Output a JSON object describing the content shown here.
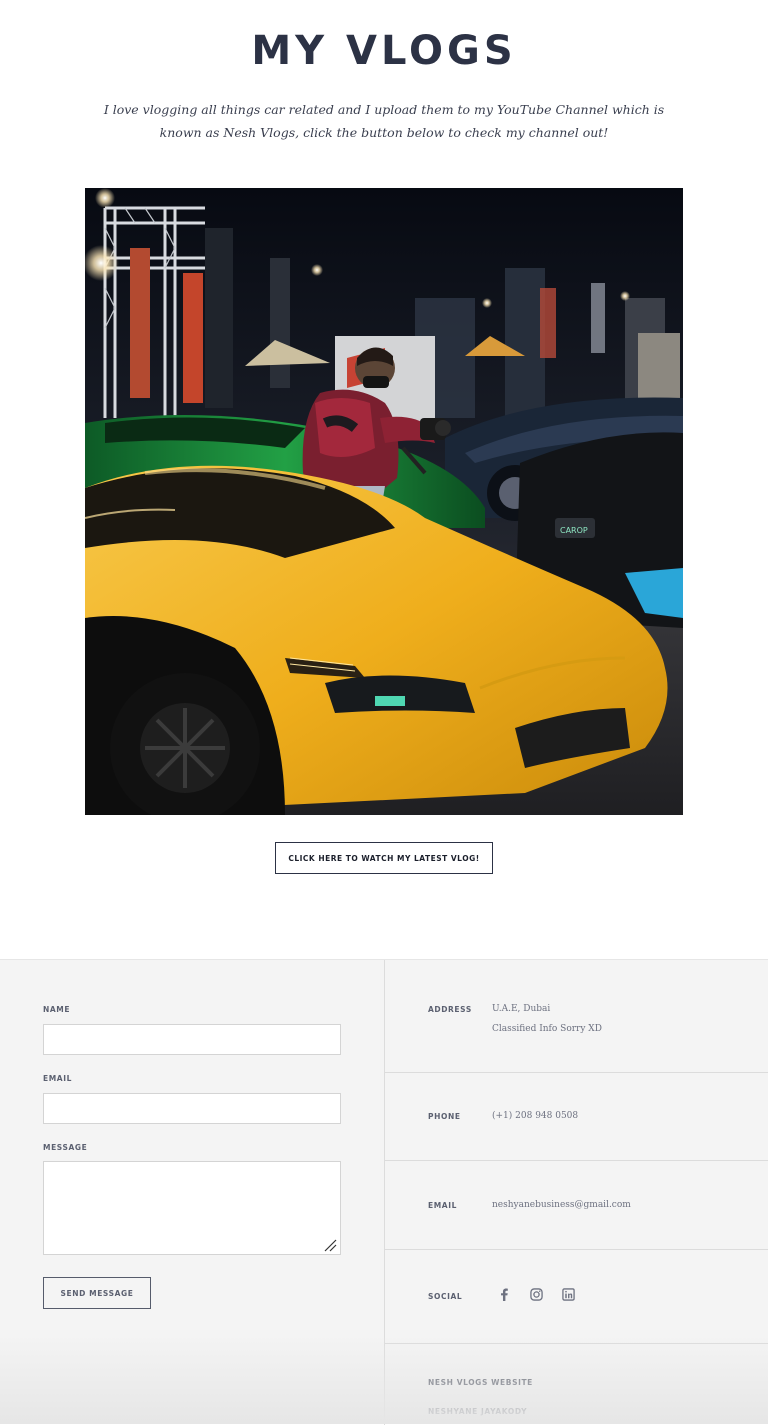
{
  "header": {
    "title": "MY VLOGS",
    "intro": "I love vlogging all things car related and I upload them to my YouTube Channel which is known as Nesh Vlogs, click the button below to check my channel out!"
  },
  "photo": {
    "caption_alt": "",
    "sign_text": "CAROP"
  },
  "cta": {
    "label": "CLICK HERE TO WATCH MY LATEST VLOG!"
  },
  "form": {
    "name_label": "NAME",
    "name_value": "",
    "email_label": "EMAIL",
    "email_value": "",
    "message_label": "MESSAGE",
    "message_value": "",
    "send_label": "SEND MESSAGE"
  },
  "contact": {
    "address_label": "ADDRESS",
    "address_line1": "U.A.E, Dubai",
    "address_line2": "Classified Info Sorry XD",
    "phone_label": "PHONE",
    "phone_value": "(+1) 208 948 0508",
    "email_label": "EMAIL",
    "email_value": "neshyanebusiness@gmail.com",
    "social_label": "SOCIAL",
    "social_icons": [
      "facebook-icon",
      "instagram-icon",
      "linkedin-icon"
    ]
  },
  "footer": {
    "link1": "NESH VLOGS WEBSITE",
    "link2": "NESHYANE JAYAKODY"
  },
  "colors": {
    "heading": "#2c3245",
    "panel_bg": "#f4f4f4",
    "car_yellow": "#f2b322",
    "car_green": "#1e8a3c"
  }
}
